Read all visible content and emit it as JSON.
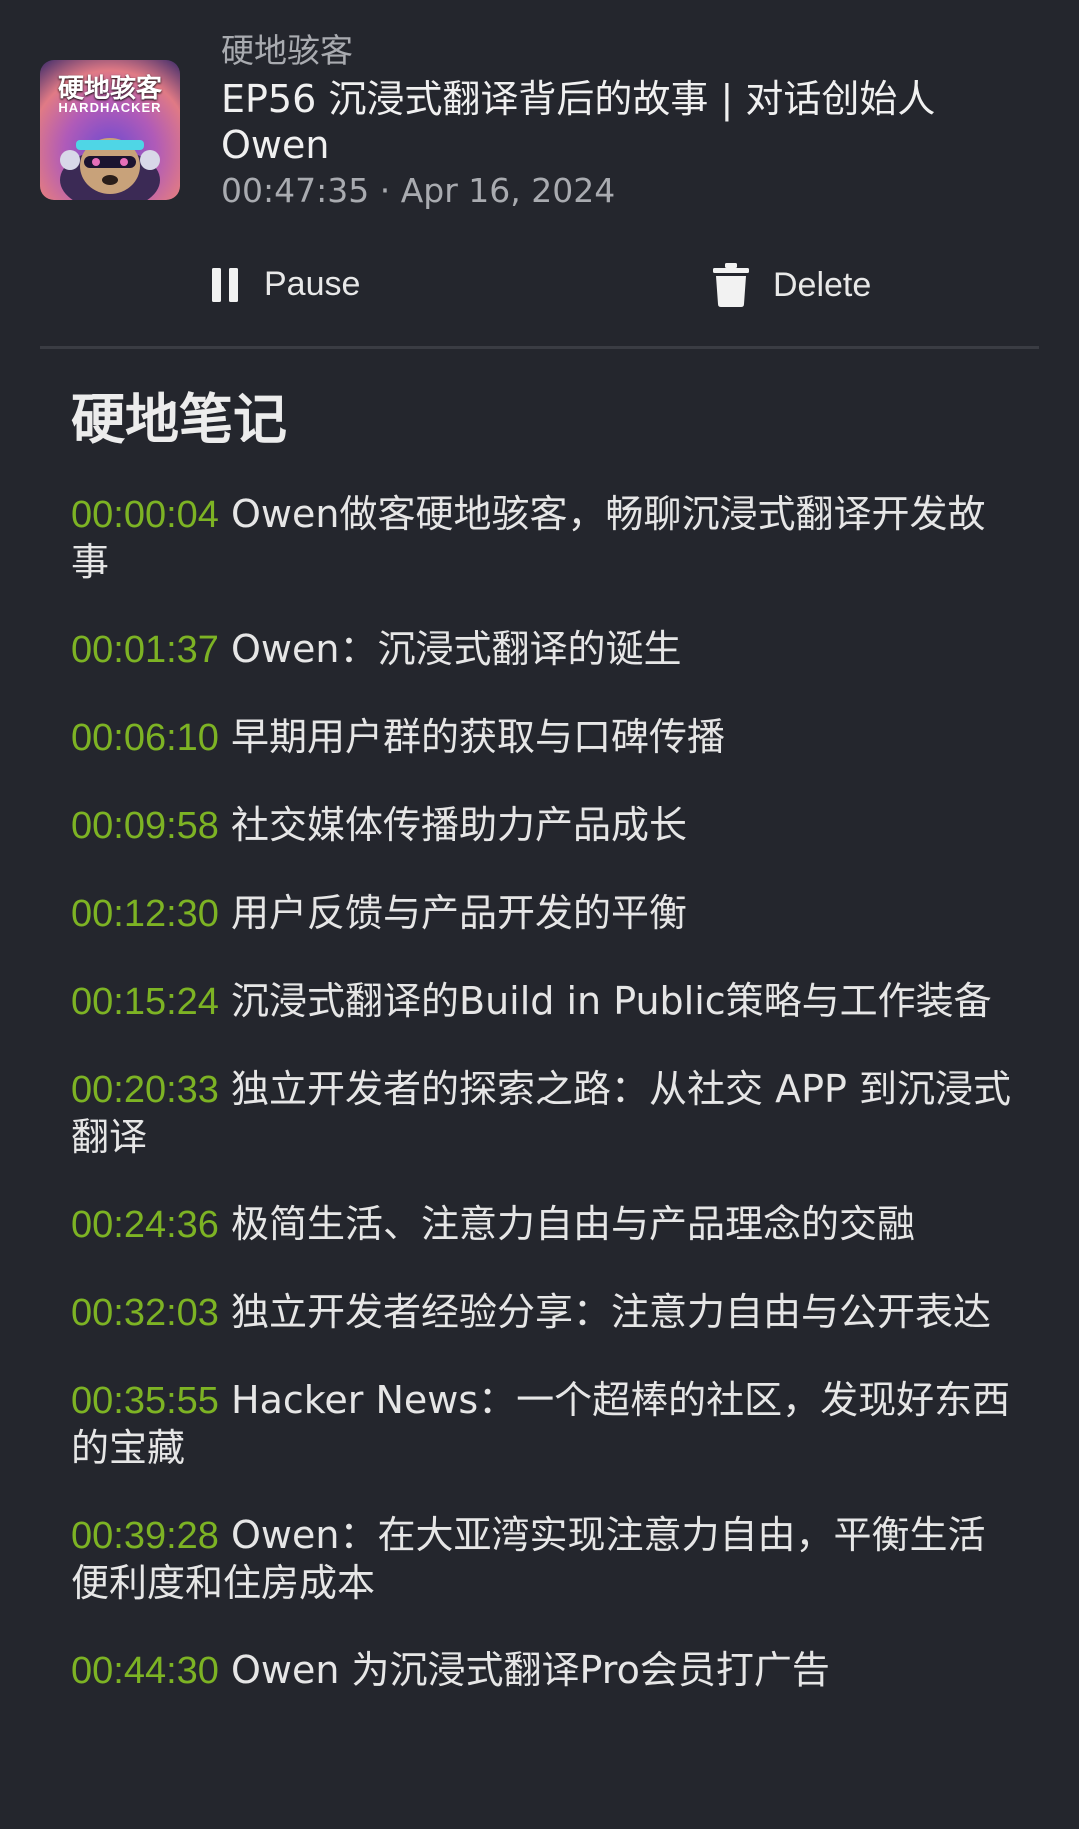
{
  "episode": {
    "podcast_name": "硬地骇客",
    "title": "EP56 沉浸式翻译背后的故事 | 对话创始人 Owen",
    "duration": "00:47:35",
    "separator": " · ",
    "date": "Apr 16, 2024",
    "cover_text_cn": "硬地骇客",
    "cover_text_en": "HARDHACKER"
  },
  "actions": {
    "pause_label": "Pause",
    "pause_icon": "pause-icon",
    "delete_label": "Delete",
    "delete_icon": "trash-icon"
  },
  "notes": {
    "title": "硬地笔记",
    "chapters": [
      {
        "time": "00:00:04",
        "text": "Owen做客硬地骇客，畅聊沉浸式翻译开发故事"
      },
      {
        "time": "00:01:37",
        "text": "Owen：沉浸式翻译的诞生"
      },
      {
        "time": "00:06:10",
        "text": "早期用户群的获取与口碑传播"
      },
      {
        "time": "00:09:58",
        "text": "社交媒体传播助力产品成长"
      },
      {
        "time": "00:12:30",
        "text": "用户反馈与产品开发的平衡"
      },
      {
        "time": "00:15:24",
        "text": "沉浸式翻译的Build in Public策略与工作装备"
      },
      {
        "time": "00:20:33",
        "text": "独立开发者的探索之路：从社交 APP 到沉浸式翻译"
      },
      {
        "time": "00:24:36",
        "text": "极简生活、注意力自由与产品理念的交融"
      },
      {
        "time": "00:32:03",
        "text": "独立开发者经验分享：注意力自由与公开表达"
      },
      {
        "time": "00:35:55",
        "text": "Hacker News：一个超棒的社区，发现好东西的宝藏"
      },
      {
        "time": "00:39:28",
        "text": "Owen：在大亚湾实现注意力自由，平衡生活便利度和住房成本"
      },
      {
        "time": "00:44:30",
        "text": "Owen 为沉浸式翻译Pro会员打广告"
      }
    ]
  },
  "colors": {
    "background": "#24262d",
    "timestamp": "#7db324",
    "text": "#e6e6e6",
    "muted": "#a9abb0"
  }
}
